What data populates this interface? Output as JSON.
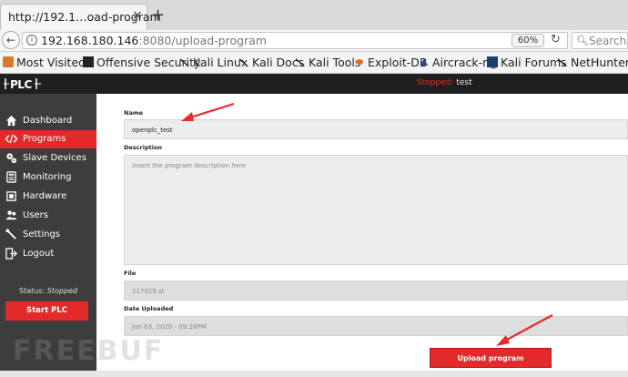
{
  "browser": {
    "tab_title": "http://192.1…oad-program",
    "tab_close": "×",
    "new_tab": "+",
    "url_host": "192.168.180.146",
    "url_rest": ":8080/upload-program",
    "zoom": "60%",
    "search_placeholder": "Search"
  },
  "bookmarks": [
    {
      "label": "Most Visited",
      "icon": "orange-box-icon"
    },
    {
      "label": "Offensive Security",
      "icon": "offsec-icon"
    },
    {
      "label": "Kali Linux",
      "icon": "kali-dragon-icon"
    },
    {
      "label": "Kali Docs",
      "icon": "kali-dragon-icon"
    },
    {
      "label": "Kali Tools",
      "icon": "kali-dragon-icon"
    },
    {
      "label": "Exploit-DB",
      "icon": "exploitdb-icon"
    },
    {
      "label": "Aircrack-ng",
      "icon": "aircrack-icon"
    },
    {
      "label": "Kali Forums",
      "icon": "kali-forums-icon"
    },
    {
      "label": "NetHunter",
      "icon": "kali-dragon-icon"
    }
  ],
  "header": {
    "logo": "OPLC",
    "status_label": "Stopped:",
    "status_program": "test"
  },
  "sidebar": {
    "items": [
      {
        "label": "Dashboard",
        "icon": "home-icon"
      },
      {
        "label": "Programs",
        "icon": "code-icon"
      },
      {
        "label": "Slave Devices",
        "icon": "gear-cluster-icon"
      },
      {
        "label": "Monitoring",
        "icon": "monitor-icon"
      },
      {
        "label": "Hardware",
        "icon": "chip-icon"
      },
      {
        "label": "Users",
        "icon": "users-icon"
      },
      {
        "label": "Settings",
        "icon": "wrench-icon"
      },
      {
        "label": "Logout",
        "icon": "logout-icon"
      }
    ],
    "active": "Programs",
    "status_prefix": "Status:",
    "status_value": "Stopped",
    "start_button": "Start PLC"
  },
  "form": {
    "name_label": "Name",
    "name_value": "openplc_test",
    "description_label": "Description",
    "description_placeholder": "Insert the program description here",
    "file_label": "File",
    "file_value": "117929.st",
    "date_label": "Date Uploaded",
    "date_value": "Jun 03, 2020 - 09:26PM",
    "upload_button": "Upload program"
  },
  "colors": {
    "accent": "#e22a2a",
    "sidebar_bg": "#3d3d3d",
    "header_bg": "#1f1f1f",
    "annotation_arrow": "#e52b2b"
  },
  "watermark": "FREEBUF"
}
